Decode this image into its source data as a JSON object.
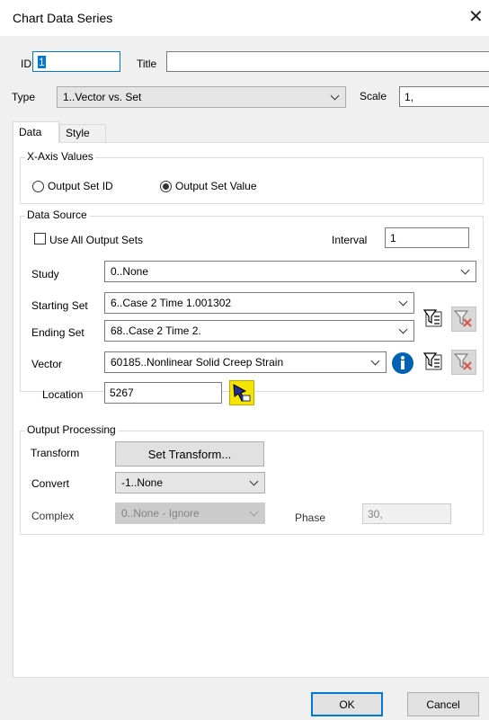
{
  "window": {
    "title": "Chart Data Series"
  },
  "id_field": {
    "label": "ID",
    "value": "1"
  },
  "title_field": {
    "label": "Title",
    "value": ""
  },
  "type_field": {
    "label": "Type",
    "value": "1..Vector vs. Set"
  },
  "scale_field": {
    "label": "Scale",
    "value": "1,"
  },
  "tabs": [
    {
      "label": "Data"
    },
    {
      "label": "Style"
    }
  ],
  "x_axis": {
    "legend": "X-Axis Values",
    "options": [
      {
        "label": "Output Set ID",
        "checked": false
      },
      {
        "label": "Output Set Value",
        "checked": true
      }
    ]
  },
  "data_source": {
    "legend": "Data Source",
    "use_all_label": "Use All Output Sets",
    "use_all_checked": false,
    "interval_label": "Interval",
    "interval_value": "1",
    "study_label": "Study",
    "study_value": "0..None",
    "starting_set_label": "Starting Set",
    "starting_set_value": "6..Case 2 Time 1.001302",
    "ending_set_label": "Ending Set",
    "ending_set_value": "68..Case 2 Time 2.",
    "vector_label": "Vector",
    "vector_value": "60185..Nonlinear Solid Creep Strain",
    "location_label": "Location",
    "location_value": "5267"
  },
  "output_processing": {
    "legend": "Output Processing",
    "transform_label": "Transform",
    "transform_button": "Set Transform...",
    "convert_label": "Convert",
    "convert_value": "-1..None",
    "complex_label": "Complex",
    "complex_value": "0..None - Ignore",
    "phase_label": "Phase",
    "phase_value": "30,"
  },
  "buttons": {
    "ok": "OK",
    "cancel": "Cancel"
  },
  "colors": {
    "accent": "#0078d7",
    "info": "#0063b1",
    "filter_clear": "#d9534f",
    "select_icon": "#f5e400"
  }
}
